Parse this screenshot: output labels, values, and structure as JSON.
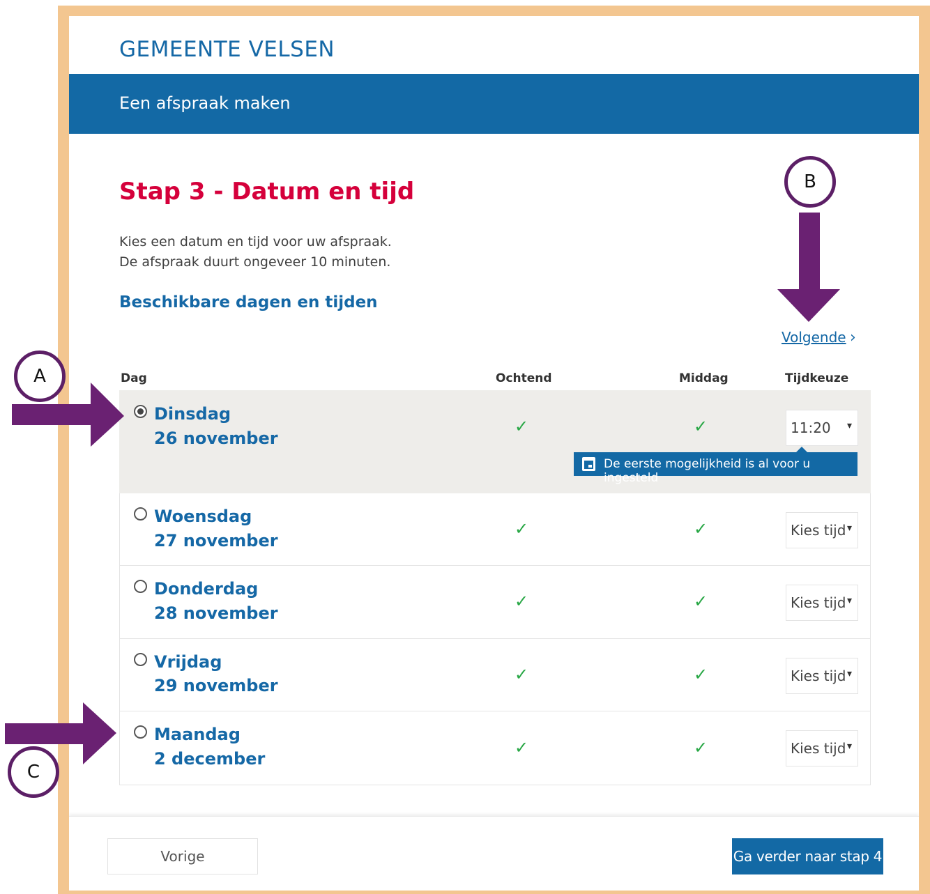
{
  "organization": "GEMEENTE VELSEN",
  "banner_title": "Een afspraak maken",
  "step_title": "Stap 3 - Datum en tijd",
  "intro_lines": [
    "Kies een datum en tijd voor uw afspraak.",
    "De afspraak duurt ongeveer 10 minuten."
  ],
  "available_heading": "Beschikbare dagen en tijden",
  "next_link": "Volgende",
  "columns": [
    "Dag",
    "Ochtend",
    "Middag",
    "Tijdkeuze"
  ],
  "rows": [
    {
      "day": "Dinsdag",
      "date": "26 november",
      "morning": "✓",
      "afternoon": "✓",
      "time": "11:20",
      "selected": true
    },
    {
      "day": "Woensdag",
      "date": "27 november",
      "morning": "✓",
      "afternoon": "✓",
      "time": "Kies tijd",
      "selected": false
    },
    {
      "day": "Donderdag",
      "date": "28 november",
      "morning": "✓",
      "afternoon": "✓",
      "time": "Kies tijd",
      "selected": false
    },
    {
      "day": "Vrijdag",
      "date": "29 november",
      "morning": "✓",
      "afternoon": "✓",
      "time": "Kies tijd",
      "selected": false
    },
    {
      "day": "Maandag",
      "date": "2 december",
      "morning": "✓",
      "afternoon": "✓",
      "time": "Kies tijd",
      "selected": false
    }
  ],
  "tooltip": "De eerste mogelijkheid is al voor u ingesteld",
  "prev_button": "Vorige",
  "next_button": "Ga verder naar stap 4",
  "markers": [
    "A",
    "B",
    "C"
  ],
  "colors": {
    "brand_blue": "#1369a5",
    "title_red": "#d5003b",
    "frame": "#f3c690",
    "arrow_purple": "#6a2172",
    "check_green": "#28a745"
  }
}
